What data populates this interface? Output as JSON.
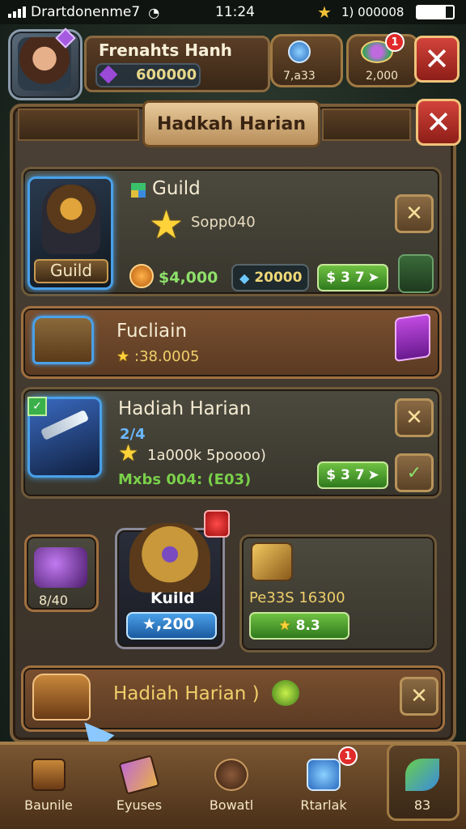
{
  "status_bar": {
    "carrier": "Drartdonenme7",
    "time": "11:24",
    "battery_text": "1) 000008"
  },
  "player": {
    "name": "Frenahts Hanh",
    "gems": "600000"
  },
  "header_slots": [
    {
      "value": "7,a33"
    },
    {
      "value": "2,000",
      "badge": "1"
    }
  ],
  "panel": {
    "title": "Hadkah Harian"
  },
  "cards": {
    "guild": {
      "portrait_label": "Guild",
      "title": "Guild",
      "score": "Sopp040",
      "coin": "$4,000",
      "gem": "20000",
      "price": "$ 3 7"
    },
    "chest": {
      "title": "Fucliain",
      "value": ":38.0005"
    },
    "daily": {
      "title": "Hadiah Harian",
      "level": "2/4",
      "sub": "1a000k 5poooo)",
      "mixed": "Mxbs 004: (E03)",
      "price": "$ 3 7"
    },
    "trio": {
      "left_value": "8/40",
      "mid_label": "Kuild",
      "mid_value": "★,200",
      "right_title": "Pe33S 16300",
      "right_btn": "8.3"
    },
    "bottom": {
      "title": "Hadiah Harian )"
    }
  },
  "nav": [
    {
      "label": "Baunile"
    },
    {
      "label": "Eyuses"
    },
    {
      "label": "Bowatl"
    },
    {
      "label": "Rtarlak",
      "badge": "1"
    },
    {
      "label": "83"
    }
  ],
  "colors": {
    "close_red": "#d2433a",
    "gold": "#f0cf6a",
    "green": "#6fc142",
    "portrait_blue": "#4aa0e8"
  }
}
